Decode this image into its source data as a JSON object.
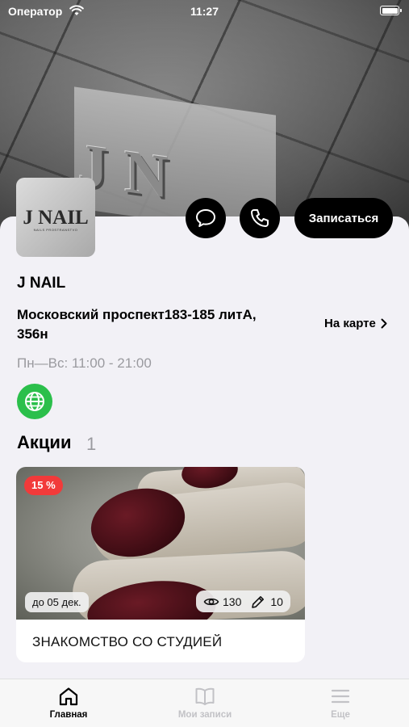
{
  "status_bar": {
    "carrier": "Оператор",
    "time": "11:27"
  },
  "salon": {
    "logo_title": "J NAIL",
    "logo_subtitle": "NAILS PROSTRANSTVO",
    "name": "J NAIL",
    "address": "Московский проспект183-185 литА, 356н",
    "hours": "Пн—Вс: 11:00 - 21:00"
  },
  "actions": {
    "book_label": "Записаться",
    "map_label": "На карте"
  },
  "promotions": {
    "heading": "Акции",
    "count": "1",
    "items": [
      {
        "discount": "15 %",
        "until": "до 05 дек.",
        "views": "130",
        "edits": "10",
        "title": "ЗНАКОМСТВО СО СТУДИЕЙ"
      }
    ]
  },
  "tabbar": {
    "home": "Главная",
    "records": "Мои записи",
    "more": "Еще"
  },
  "colors": {
    "accent": "#000000",
    "discount": "#f23a3a",
    "web_icon": "#2bbf4b",
    "inactive_tab": "#c2c2c6"
  }
}
